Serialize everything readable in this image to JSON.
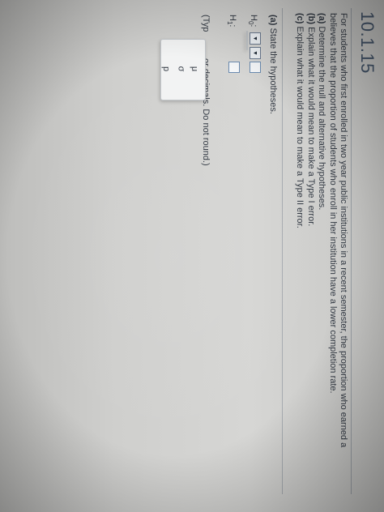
{
  "header": {
    "problem_number": "10.1.15"
  },
  "problem": {
    "statement": "For students who first enrolled in two year public institutions in a recent semester, the proportion who earned a",
    "statement_line2": "believes that the proportion of students who enroll in her institution have a lower completion rate.",
    "part_a_label": "(a)",
    "part_a_text": " Determine the null and alternative hypotheses.",
    "part_b_label": "(b)",
    "part_b_text": " Explain what it would mean to make a Type I error.",
    "part_c_label": "(c)",
    "part_c_text": " Explain what it would mean to make a Type II error."
  },
  "section_a": {
    "label": "(a)",
    "text": " State the hypotheses."
  },
  "hypotheses": {
    "h0_label": "H",
    "h0_sub": "0",
    "h0_colon": ":",
    "h1_label": "H",
    "h1_sub": "1",
    "h1_colon": ":",
    "type_hint_prefix": "(Typ",
    "type_hint_suffix": "or decimals. Do not round.)"
  },
  "dropdown": {
    "options": [
      "p",
      "σ",
      "μ"
    ]
  }
}
